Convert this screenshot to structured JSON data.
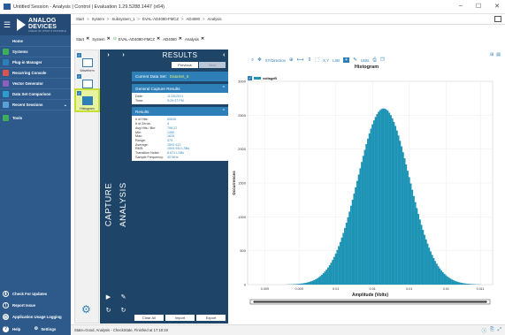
{
  "window": {
    "title": "Untitled Session - Analysis | Control | Evaluation 1.29.5288.1447 (x64)",
    "controls": [
      "–",
      "☐",
      "✕"
    ]
  },
  "brand": {
    "name_line1": "ANALOG",
    "name_line2": "DEVICES",
    "tagline": "AHEAD OF WHAT'S POSSIBLE"
  },
  "nav": {
    "top_items": [
      {
        "label": "Home",
        "icon": "home-icon"
      },
      {
        "label": "Systems",
        "icon": "systems-icon"
      },
      {
        "label": "Plug-in Manager",
        "icon": "plugin-manager-icon"
      },
      {
        "label": "Recurring Console",
        "icon": "console-icon"
      },
      {
        "label": "Vector Generator",
        "icon": "vector-generator-icon"
      },
      {
        "label": "Data Set Comparison",
        "icon": "comparison-icon"
      },
      {
        "label": "Recent Sessions",
        "icon": "recent-sessions-icon"
      },
      {
        "label": "Tools",
        "icon": "tools-icon"
      }
    ],
    "bottom_items": [
      {
        "label": "Check For Updates",
        "icon": "updates-icon"
      },
      {
        "label": "Report Issue",
        "icon": "report-icon"
      },
      {
        "label": "Application Usage Logging",
        "icon": "logging-icon"
      }
    ],
    "help_label": "Help",
    "settings_label": "Settings"
  },
  "path": {
    "crumbs": [
      "Start",
      "System",
      "Subsystem_1",
      "EVAL-AD4080-FMCZ",
      "AD4080",
      "Analysis"
    ]
  },
  "tabs": [
    {
      "label": "Start",
      "closable": true
    },
    {
      "label": "System",
      "closable": true
    },
    {
      "label": "EVAL-AD4080-FMCZ",
      "closable": true,
      "ok": true
    },
    {
      "label": "AD4080",
      "closable": true
    },
    {
      "label": "Analysis",
      "closable": true
    }
  ],
  "plugins": [
    {
      "label": "Waveform"
    },
    {
      "label": "FFT"
    },
    {
      "label": "Histogram",
      "selected": true
    }
  ],
  "panels": {
    "capture_label": "CAPTURE",
    "analysis_label": "ANALYSIS"
  },
  "results": {
    "title": "RESULTS",
    "previous": "Previous",
    "next": "Next",
    "current_label": "Current Data Set:",
    "current_value": "DataSet_6",
    "general_header": "General Capture Results",
    "general": [
      {
        "k": "Date:",
        "v": "11/26/2021"
      },
      {
        "k": "Time:",
        "v": "5:29:37 PM"
      }
    ],
    "results_header": "Results",
    "stats": [
      {
        "k": "# of Hits:",
        "v": "65536"
      },
      {
        "k": "# of Zeros:",
        "v": "4"
      },
      {
        "k": "Avg Hits / Bin:",
        "v": "798.22"
      },
      {
        "k": "Min:",
        "v": "1350"
      },
      {
        "k": "Max:",
        "v": "1825"
      },
      {
        "k": "Range:",
        "v": "475"
      },
      {
        "k": "Average:",
        "v": "1593.413"
      },
      {
        "k": "RMS:",
        "v": "1593.940 LSBs"
      },
      {
        "k": "Transition Noise:",
        "v": "8.671 LSBs"
      },
      {
        "k": "Sample Frequency:",
        "v": "40 MHz"
      }
    ],
    "buttons": [
      "Clear All",
      "Import",
      "Export"
    ]
  },
  "toolbar": {
    "xy_label": "XY/Direction",
    "xy_zoom": "X,Y",
    "units_label": "Units",
    "lsb_label": "LSB"
  },
  "chart_data": {
    "type": "bar",
    "title": "Histogram",
    "xlabel": "Amplitude (Volts)",
    "ylabel": "Occurrences",
    "legend": [
      {
        "name": "voltageB",
        "color": "#1d94b5"
      }
    ],
    "bar_color": "#1d94b5",
    "ylim": [
      0,
      3000
    ],
    "yticks": [
      0,
      500,
      1000,
      1500,
      2000,
      2500,
      3000
    ],
    "xlim": [
      0,
      1
    ],
    "xticks": [
      {
        "pos": 0.07,
        "label": "0.009"
      },
      {
        "pos": 0.21,
        "label": "0.009"
      },
      {
        "pos": 0.36,
        "label": "0.01"
      },
      {
        "pos": 0.51,
        "label": "0.01"
      },
      {
        "pos": 0.66,
        "label": "0.01"
      },
      {
        "pos": 0.81,
        "label": "0.01"
      },
      {
        "pos": 0.95,
        "label": "0.011"
      }
    ],
    "distribution": {
      "shape": "gaussian",
      "center": 0.555,
      "sigma": 0.105,
      "peak": 2600
    },
    "grid": true
  },
  "status": {
    "text": "State=Good, Analysis - CheckState, Finished at 17:18:19"
  }
}
